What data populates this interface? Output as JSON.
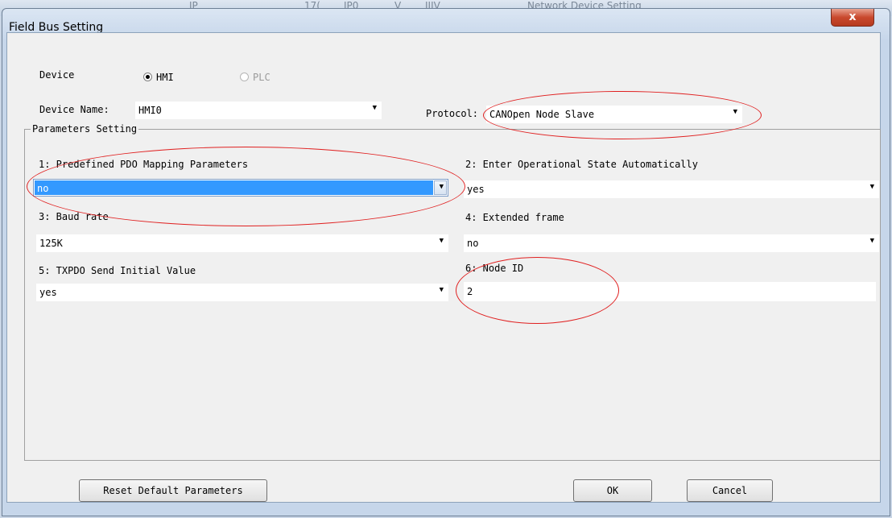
{
  "background": {
    "text_1": "IP",
    "text_2": "17(",
    "text_3": "IP0",
    "text_4": "V",
    "text_5": "IIIV",
    "text_6": "Network Device Setting"
  },
  "window": {
    "title": "Field Bus Setting",
    "close_symbol": "x"
  },
  "device": {
    "label": "Device",
    "options": [
      {
        "label": "HMI",
        "selected": true,
        "enabled": true
      },
      {
        "label": "PLC",
        "selected": false,
        "enabled": false
      }
    ]
  },
  "device_name": {
    "label": "Device Name:",
    "value": "HMI0"
  },
  "protocol": {
    "label": "Protocol:",
    "value": "CANOpen Node Slave"
  },
  "parameters": {
    "group_title": "Parameters Setting",
    "p1": {
      "label": "1: Predefined PDO Mapping Parameters",
      "value": "no"
    },
    "p2": {
      "label": "2: Enter Operational State Automatically",
      "value": "yes"
    },
    "p3": {
      "label": "3: Baud rate",
      "value": "125K"
    },
    "p4": {
      "label": "4: Extended frame",
      "value": "no"
    },
    "p5": {
      "label": "5: TXPDO Send Initial Value",
      "value": "yes"
    },
    "p6": {
      "label": "6: Node ID",
      "value": "2"
    }
  },
  "buttons": {
    "reset": "Reset Default Parameters",
    "ok": "OK",
    "cancel": "Cancel"
  },
  "icons": {
    "dropdown_arrow": "▼"
  },
  "colors": {
    "selection": "#3399ff",
    "annotation": "#e02020",
    "close_button": "#c9492e"
  }
}
